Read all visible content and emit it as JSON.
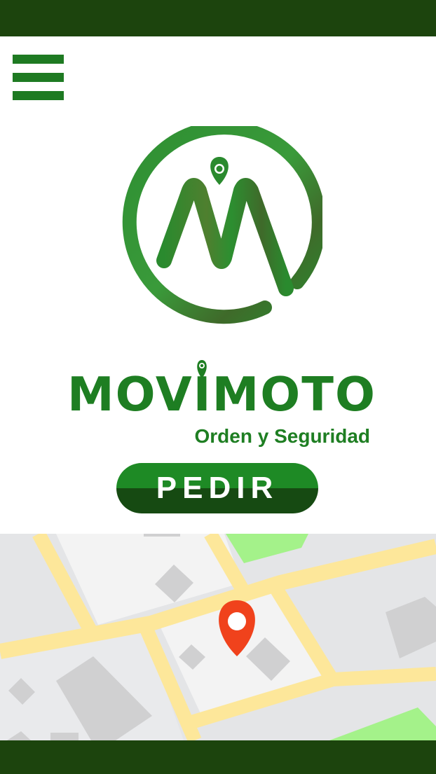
{
  "app": {
    "brand_name": "MOVIMOTO",
    "tagline": "Orden y Seguridad"
  },
  "actions": {
    "order_label": "PEDIR"
  },
  "icons": {
    "menu": "hamburger-menu-icon",
    "logo": "movimoto-logo-icon",
    "map_pin": "map-pin-icon"
  },
  "colors": {
    "header_bar": "#1c440d",
    "brand_green": "#1e7e22",
    "button_top": "#1e8a25",
    "button_bottom": "#164a12",
    "map_pin": "#f0421c",
    "map_road": "#fde79a",
    "map_park": "#a4f28a"
  }
}
